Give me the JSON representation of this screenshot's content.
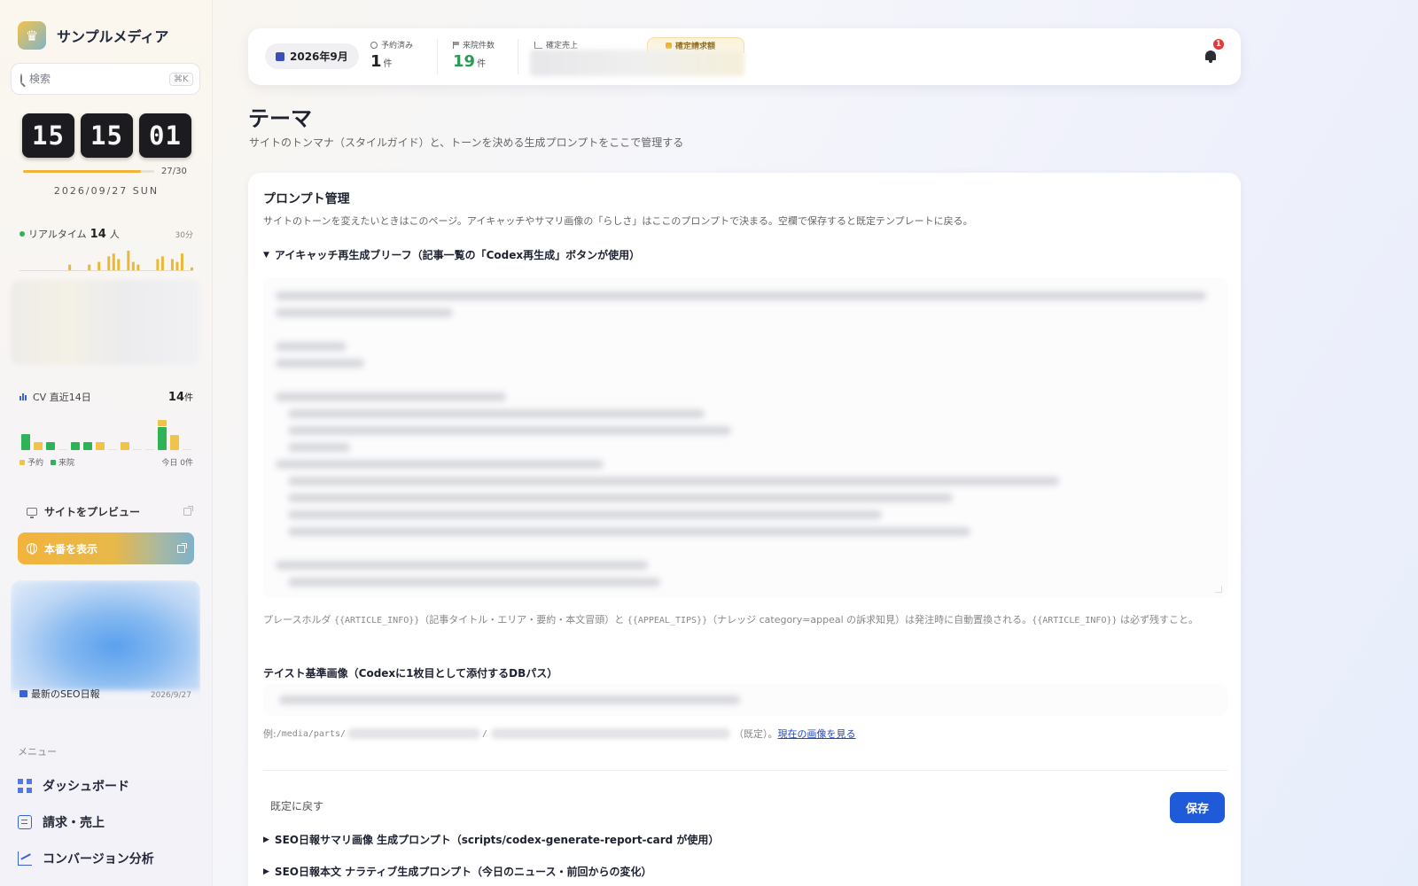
{
  "brand": {
    "name": "サンプルメディア"
  },
  "search": {
    "placeholder": "検索",
    "shortcut": "⌘K"
  },
  "clock": {
    "h": "15",
    "m": "15",
    "s": "01",
    "progress_label": "27/30",
    "progress": 0.9,
    "date": "2026/09/27 SUN"
  },
  "realtime": {
    "label": "リアルタイム",
    "count": "14",
    "unit": "人",
    "window": "30分",
    "bars": [
      0,
      0,
      0,
      0,
      0,
      0,
      0,
      0,
      0,
      0,
      2,
      0,
      0,
      0,
      2,
      0,
      3,
      0,
      5,
      6,
      4,
      0,
      7,
      3,
      2,
      0,
      0,
      0,
      4,
      5,
      0,
      4,
      3,
      6,
      0,
      1
    ]
  },
  "cv": {
    "label": "CV 直近14日",
    "count": "14",
    "unit": "件",
    "reserve_color": "#f1c34b",
    "visit_color": "#2fb359",
    "days": [
      {
        "visit": 2,
        "reserve": 0
      },
      {
        "visit": 0,
        "reserve": 1
      },
      {
        "visit": 1,
        "reserve": 0
      },
      {
        "visit": 0,
        "reserve": 0
      },
      {
        "visit": 1,
        "reserve": 0
      },
      {
        "visit": 1,
        "reserve": 0
      },
      {
        "visit": 0,
        "reserve": 1
      },
      {
        "visit": 0,
        "reserve": 0
      },
      {
        "visit": 0,
        "reserve": 1
      },
      {
        "visit": 0,
        "reserve": 0
      },
      {
        "visit": 0,
        "reserve": 0
      },
      {
        "visit": 3,
        "reserve": 1
      },
      {
        "visit": 0,
        "reserve": 2
      },
      {
        "visit": 0,
        "reserve": 0
      }
    ],
    "legend_reserve": "予約",
    "legend_visit": "来院",
    "today": "今日 0件"
  },
  "nav": {
    "preview": "サイトをプレビュー",
    "live": "本番を表示",
    "seo_title": "最新のSEO日報",
    "seo_date": "2026/9/27",
    "menu_label": "メニュー",
    "menu": [
      "ダッシュボード",
      "請求・売上",
      "コンバージョン分析"
    ]
  },
  "topbar": {
    "month": "2026年9月",
    "reserved_label": "予約済み",
    "reserved_value": "1",
    "reserved_unit": "件",
    "visits_label": "来院件数",
    "visits_value": "19",
    "visits_unit": "件",
    "revenue_label": "確定売上",
    "billing_label": "確定請求額",
    "notifications": "1"
  },
  "page": {
    "title": "テーマ",
    "subtitle": "サイトのトンマナ（スタイルガイド）と、トーンを決める生成プロンプトをここで管理する"
  },
  "prompt": {
    "title": "プロンプト管理",
    "desc": "サイトのトーンを変えたいときはこのページ。アイキャッチやサマリ画像の「らしさ」はここのプロンプトで決まる。空欄で保存すると既定テンプレートに戻る。",
    "section1": "アイキャッチ再生成ブリーフ（記事一覧の「Codex再生成」ボタンが使用）",
    "helper_a": "プレースホルダ ",
    "ph1": "{{ARTICLE_INFO}}",
    "helper_b": "（記事タイトル・エリア・要約・本文冒頭）と ",
    "ph2": "{{APPEAL_TIPS}}",
    "helper_c": "（ナレッジ category=appeal の訴求知見）は発注時に自動置換される。",
    "ph3": "{{ARTICLE_INFO}}",
    "helper_d": " は必ず残すこと。",
    "taste_label": "テイスト基準画像（Codexに1枚目として添付するDBパス）",
    "example_prefix": "例: ",
    "example_path": "/media/parts/",
    "example_slash": "/",
    "example_suffix": "（既定）。",
    "example_link": "現在の画像を見る",
    "reset": "既定に戻す",
    "save": "保存",
    "section2": "SEO日報サマリ画像 生成プロンプト（scripts/codex-generate-report-card が使用）",
    "section3": "SEO日報本文 ナラティブ生成プロンプト（今日のニュース・前回からの変化）"
  }
}
